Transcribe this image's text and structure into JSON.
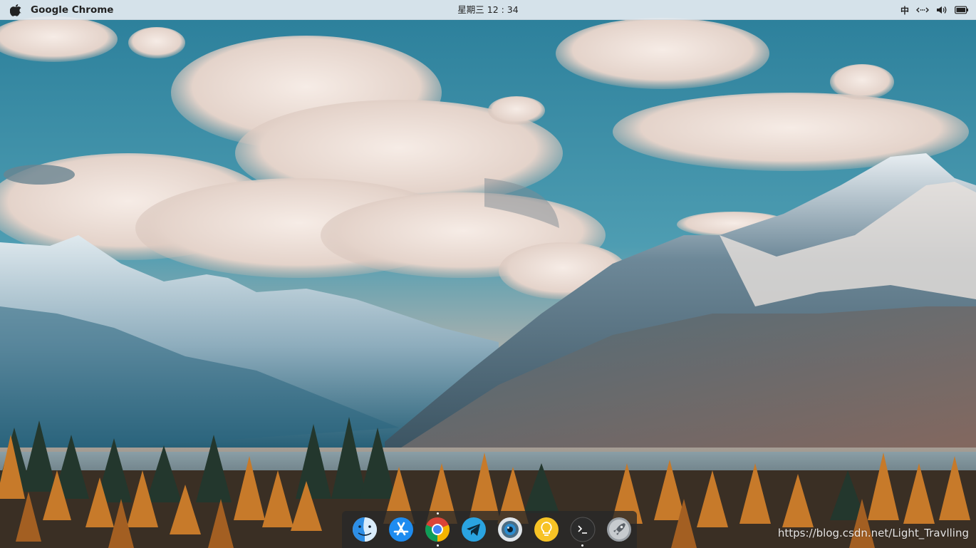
{
  "menubar": {
    "app_name": "Google Chrome",
    "clock": "星期三 12 : 34",
    "input_method": "中",
    "icons": [
      "apple-icon",
      "network-icon",
      "volume-icon",
      "battery-icon"
    ]
  },
  "dock": {
    "items": [
      {
        "name": "finder-icon",
        "label": "Finder",
        "color": "#4aa3ea",
        "running": false
      },
      {
        "name": "app-store-icon",
        "label": "App Store",
        "color": "#1e8cf0",
        "running": false
      },
      {
        "name": "chrome-icon",
        "label": "Google Chrome",
        "color": "#db4437",
        "running": true,
        "focused": true
      },
      {
        "name": "telegram-icon",
        "label": "Telegram",
        "color": "#2aa3e0",
        "running": false
      },
      {
        "name": "camera-icon",
        "label": "Camera",
        "color": "#6a8fa6",
        "running": false
      },
      {
        "name": "lightbulb-icon",
        "label": "Ideas",
        "color": "#f7c325",
        "running": false
      },
      {
        "name": "terminal-icon",
        "label": "Terminal",
        "color": "#2b2b2b",
        "running": true
      },
      {
        "name": "launchpad-icon",
        "label": "Launchpad",
        "color": "#9aa0a6",
        "running": false
      }
    ]
  },
  "watermark": "https://blog.csdn.net/Light_Travlling",
  "colors": {
    "menubar_bg": "#e2eaf0",
    "dock_bg": "#282828",
    "sky": "#2f86a3"
  }
}
